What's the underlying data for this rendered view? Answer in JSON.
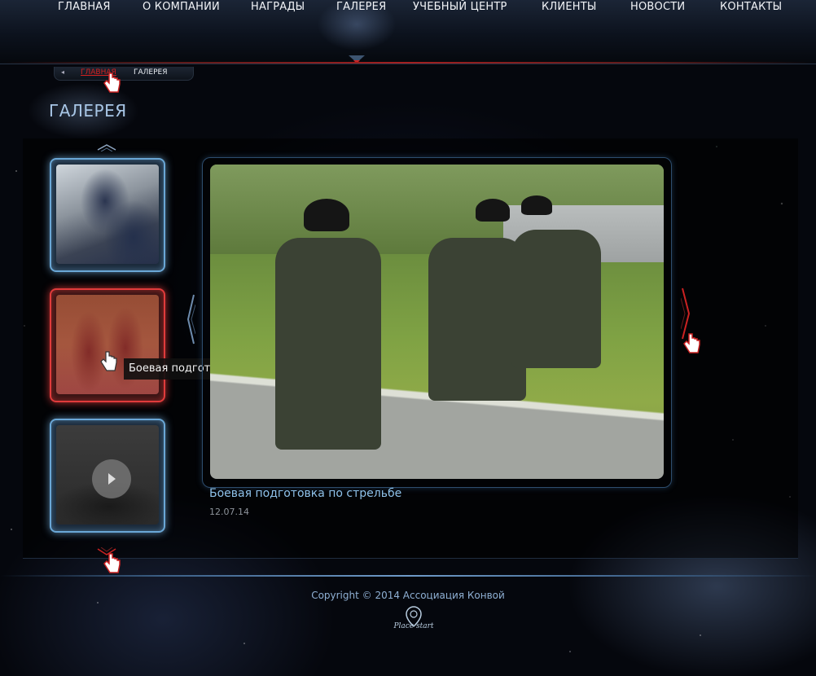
{
  "nav": {
    "items": [
      "ГЛАВНАЯ",
      "О КОМПАНИИ",
      "НАГРАДЫ",
      "ГАЛЕРЕЯ",
      "УЧЕБНЫЙ  ЦЕНТР",
      "КЛИЕНТЫ",
      "НОВОСТИ",
      "КОНТАКТЫ"
    ],
    "active": "ГАЛЕРЕЯ"
  },
  "breadcrumb": {
    "home": "ГЛАВНАЯ",
    "current": "ГАЛЕРЕЯ"
  },
  "page_title": "ГАЛЕРЕЯ",
  "gallery": {
    "thumbnails": [
      {
        "name": "thumb-officers",
        "state": "normal"
      },
      {
        "name": "thumb-shooting",
        "state": "hover"
      },
      {
        "name": "thumb-video",
        "state": "video"
      }
    ],
    "tooltip": "Боевая подготовка по стрельбе",
    "main_caption": "Боевая подготовка по стрельбе",
    "main_date": "12.07.14"
  },
  "footer": {
    "copyright": "Copyright © 2014 Ассоциация Конвой",
    "logo_text": "Place start"
  },
  "colors": {
    "accent_blue": "#8fc2ea",
    "accent_red": "#d62121",
    "background": "#05070d"
  }
}
